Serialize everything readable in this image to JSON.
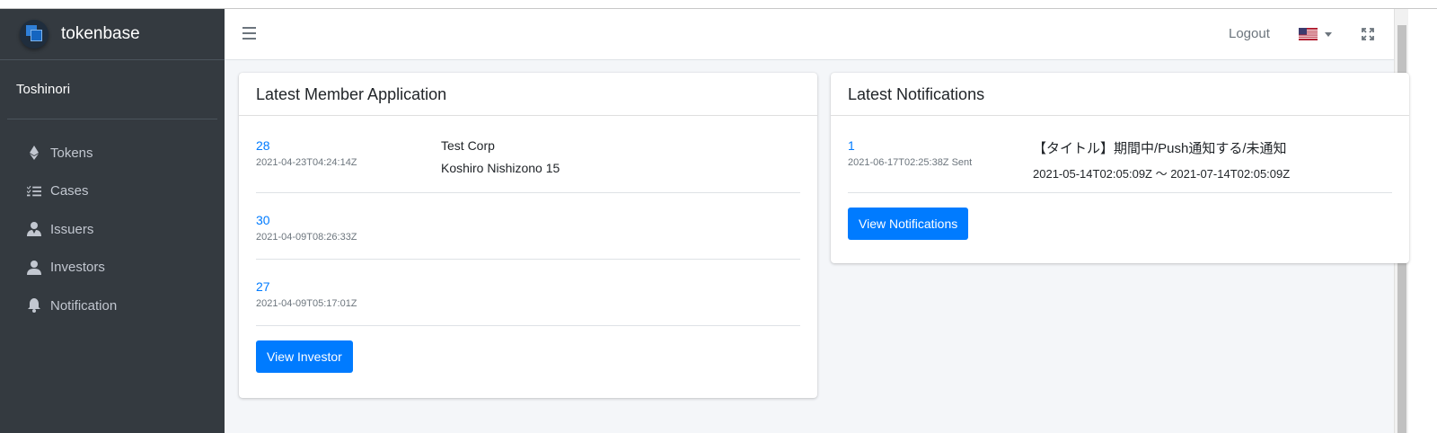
{
  "brand": {
    "name": "tokenbase"
  },
  "user": {
    "name": "Toshinori"
  },
  "sidebar": {
    "items": [
      {
        "label": "Tokens",
        "icon": "ethereum-icon"
      },
      {
        "label": "Cases",
        "icon": "list-check-icon"
      },
      {
        "label": "Issuers",
        "icon": "user-tie-icon"
      },
      {
        "label": "Investors",
        "icon": "user-icon"
      },
      {
        "label": "Notification",
        "icon": "bell-icon"
      }
    ]
  },
  "topbar": {
    "logout_label": "Logout",
    "language_icon": "us-flag-icon",
    "expand_icon": "expand-icon",
    "menu_icon": "hamburger-icon"
  },
  "member_card": {
    "title": "Latest Member Application",
    "rows": [
      {
        "id": "28",
        "timestamp": "2021-04-23T04:24:14Z",
        "line1": "Test Corp",
        "line2": "Koshiro Nishizono 15"
      },
      {
        "id": "30",
        "timestamp": "2021-04-09T08:26:33Z",
        "line1": "",
        "line2": ""
      },
      {
        "id": "27",
        "timestamp": "2021-04-09T05:17:01Z",
        "line1": "",
        "line2": ""
      }
    ],
    "button_label": "View Investor"
  },
  "notifications_card": {
    "title": "Latest Notifications",
    "rows": [
      {
        "id": "1",
        "meta": "2021-06-17T02:25:38Z Sent",
        "title": "【タイトル】期間中/Push通知する/未通知",
        "period": "2021-05-14T02:05:09Z 〜 2021-07-14T02:05:09Z"
      }
    ],
    "button_label": "View Notifications"
  },
  "colors": {
    "sidebar_bg": "#343a40",
    "primary": "#007bff",
    "content_bg": "#f4f6f9"
  }
}
